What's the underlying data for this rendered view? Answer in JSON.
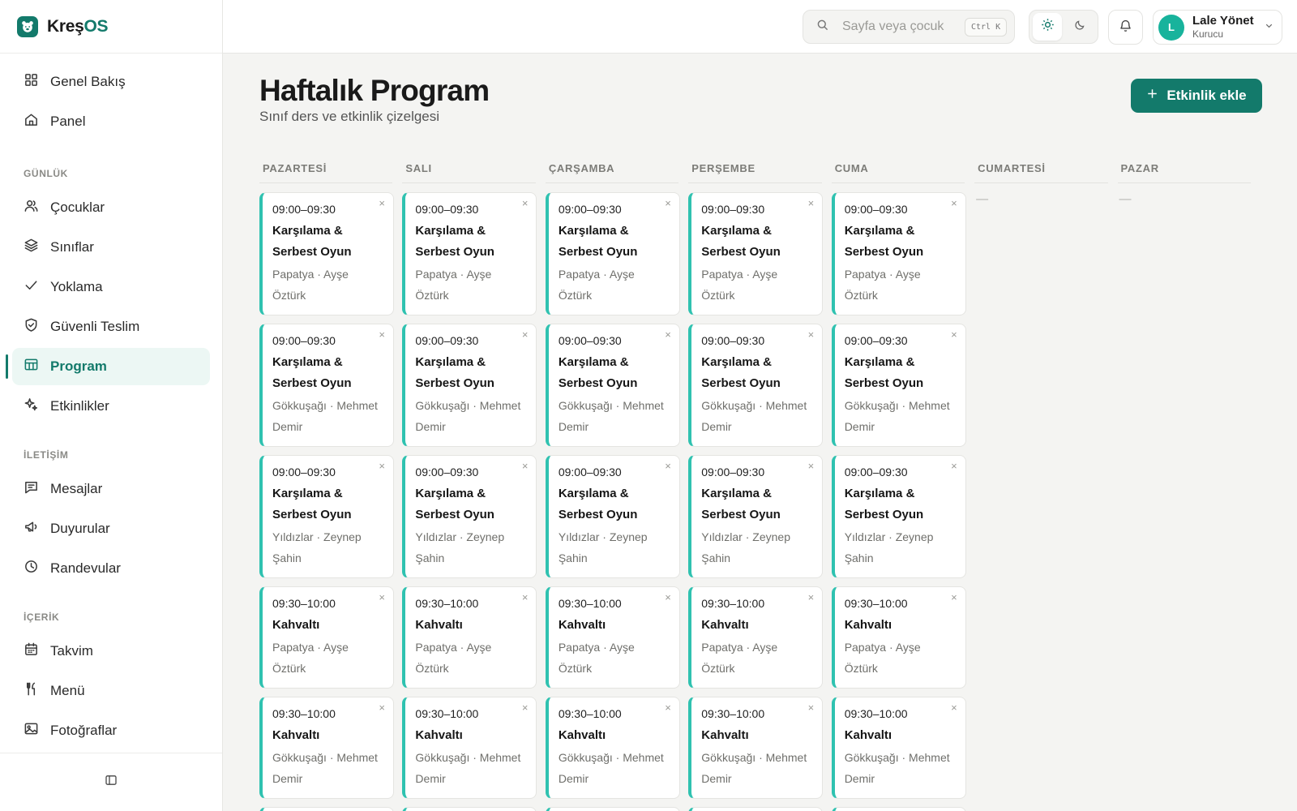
{
  "brand": {
    "name_main": "Kreş",
    "name_accent": "OS"
  },
  "sidebar": {
    "top_items": [
      {
        "label": "Genel Bakış",
        "icon": "grid-icon"
      },
      {
        "label": "Panel",
        "icon": "home-icon"
      }
    ],
    "sections": [
      {
        "title": "GÜNLÜK",
        "items": [
          {
            "label": "Çocuklar",
            "icon": "users-icon"
          },
          {
            "label": "Sınıflar",
            "icon": "layers-icon"
          },
          {
            "label": "Yoklama",
            "icon": "check-icon"
          },
          {
            "label": "Güvenli Teslim",
            "icon": "shield-icon"
          },
          {
            "label": "Program",
            "icon": "table-icon",
            "active": true
          },
          {
            "label": "Etkinlikler",
            "icon": "sparkles-icon"
          }
        ]
      },
      {
        "title": "İLETİŞİM",
        "items": [
          {
            "label": "Mesajlar",
            "icon": "message-icon"
          },
          {
            "label": "Duyurular",
            "icon": "megaphone-icon"
          },
          {
            "label": "Randevular",
            "icon": "clock-icon"
          }
        ]
      },
      {
        "title": "İÇERİK",
        "items": [
          {
            "label": "Takvim",
            "icon": "calendar-icon"
          },
          {
            "label": "Menü",
            "icon": "utensils-icon"
          },
          {
            "label": "Fotoğraflar",
            "icon": "image-icon"
          }
        ]
      }
    ]
  },
  "topbar": {
    "search_placeholder": "Sayfa veya çocuk",
    "search_shortcut": "Ctrl K",
    "user": {
      "initial": "L",
      "name": "Lale Yönet",
      "role": "Kurucu"
    }
  },
  "page": {
    "title": "Haftalık Program",
    "subtitle": "Sınıf ders ve etkinlik çizelgesi",
    "add_button": "Etkinlik ekle"
  },
  "schedule": {
    "close_glyph": "×",
    "empty_marker": "—",
    "days": [
      {
        "name": "PAZARTESİ",
        "has_events": true
      },
      {
        "name": "SALI",
        "has_events": true
      },
      {
        "name": "ÇARŞAMBA",
        "has_events": true
      },
      {
        "name": "PERŞEMBE",
        "has_events": true
      },
      {
        "name": "CUMA",
        "has_events": true
      },
      {
        "name": "CUMARTESİ",
        "has_events": false
      },
      {
        "name": "PAZAR",
        "has_events": false
      }
    ],
    "events": [
      {
        "time": "09:00–09:30",
        "title": "Karşılama & Serbest Oyun",
        "meta": "Papatya · Ayşe Öztürk"
      },
      {
        "time": "09:00–09:30",
        "title": "Karşılama & Serbest Oyun",
        "meta": "Gökkuşağı · Mehmet Demir"
      },
      {
        "time": "09:00–09:30",
        "title": "Karşılama & Serbest Oyun",
        "meta": "Yıldızlar · Zeynep Şahin"
      },
      {
        "time": "09:30–10:00",
        "title": "Kahvaltı",
        "meta": "Papatya · Ayşe Öztürk"
      },
      {
        "time": "09:30–10:00",
        "title": "Kahvaltı",
        "meta": "Gökkuşağı · Mehmet Demir"
      },
      {
        "time": "09:30–10:00",
        "title": "",
        "meta": ""
      }
    ]
  },
  "colors": {
    "accent": "#137a6b",
    "card_border": "#2fc2b0",
    "avatar": "#18b39c"
  }
}
